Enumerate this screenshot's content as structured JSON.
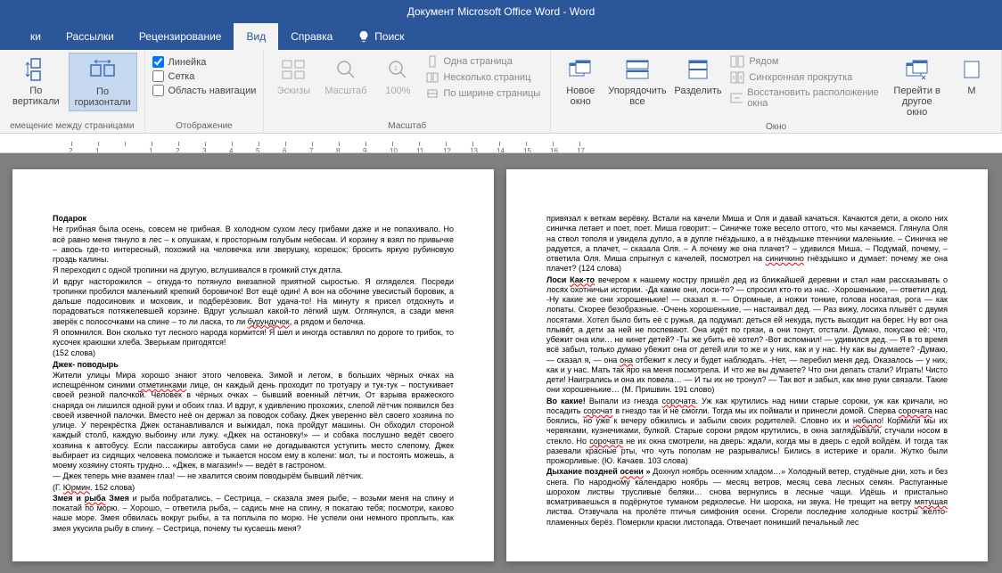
{
  "title": "Документ Microsoft Office Word  -  Word",
  "tabs": [
    "ки",
    "Рассылки",
    "Рецензирование",
    "Вид",
    "Справка"
  ],
  "activeTab": 3,
  "search": "Поиск",
  "ribbon": {
    "group1": {
      "label": "емещение между страницами",
      "btn1": "По\nвертикали",
      "btn2": "По\nгоризонтали"
    },
    "group2": {
      "label": "Отображение",
      "chk1": "Линейка",
      "chk2": "Сетка",
      "chk3": "Область навигации"
    },
    "group3": {
      "label": "Масштаб",
      "btn1": "Эскизы",
      "btn2": "Масштаб",
      "btn3": "100%",
      "opt1": "Одна страница",
      "opt2": "Несколько страниц",
      "opt3": "По ширине страницы"
    },
    "group4": {
      "label": "Окно",
      "btn1": "Новое\nокно",
      "btn2": "Упорядочить\nвсе",
      "btn3": "Разделить",
      "opt1": "Рядом",
      "opt2": "Синхронная прокрутка",
      "opt3": "Восстановить расположение окна",
      "btn4": "Перейти в\nдругое окно",
      "btn5": "М"
    }
  },
  "ruler": [
    "2",
    "1",
    "",
    "1",
    "2",
    "3",
    "4",
    "5",
    "6",
    "7",
    "8",
    "9",
    "10",
    "11",
    "12",
    "13",
    "14",
    "15",
    "16",
    "17"
  ],
  "page1": {
    "h1": "Подарок",
    "p1": "Не грибная была осень, совсем не грибная. В холодном сухом лесу грибами даже и не попахивало. Но всё равно меня тянуло в лес – к опушкам, к просторным голубым небесам. И корзину я взял по привычке – авось где-то интересный, похожий на человечка или зверушку, корешок; бросить яркую рубиновую гроздь калины.",
    "p2": "Я переходил с одной тропинки на другую, вслушивался в громкий стук дятла.",
    "p3": "И вдруг насторожился – откуда-то потянуло внезапной приятной сыростью. Я огляделся. Посреди тропинки пробился маленький крепкий боровичок! Вот ещё один! А вон на обочине увесистый боровик, а дальше подосиновик и моховик, и подберёзовик. Вот удача-то! На минуту я присел отдохнуть и порадоваться потяжелевшей корзине. Вдруг услышал какой-то лёгкий шум. Оглянулся, а сзади меня зверёк с полосочками на спине – то ли ласка, то ли ",
    "p3err": "бурундучок",
    "p3b": ", а рядом и белочка.",
    "p4": "Я опомнился. Вон сколько тут лесного народа кормится! Я шел и иногда оставлял по дороге то грибок, то кусочек краюшки хлеба. Зверькам пригодятся!",
    "p5": "(152 слова)",
    "h2": "Джек- поводырь",
    "p6a": "Жители улицы Мира хорошо знают этого человека. Зимой и летом, в больших чёрных очках на испещрённом синими ",
    "p6err": "отметинками",
    "p6b": " лице, он каждый день проходит по тротуару и тук-тук – постукивает своей резной палочкой. Человек в чёрных очках – бывший военный лётчик. От взрыва вражеского снаряда он лишился одной руки и обоих глаз. И вдруг, к удивлению прохожих, слепой лётчик появился без своей извечной палочки. Вместо неё он держал за поводок собаку. Джек уверенно вёл своего хозяина по улице. У перекрёстка Джек останавливался и выжидал, пока пройдут машины. Он обходил стороной каждый столб, каждую выбоину или лужу. «Джек на остановку!» — и собака послушно ведёт своего хозяина к автобусу. Если пассажиры автобуса сами не догадываются уступить место слепому, Джек выбирает из сидящих человека помоложе и тыкается носом ему в колени: мол, ты и постоять можешь, а моему хозяину стоять трудно… «Джек, в магазин!» — ведёт в гастроном.",
    "p7": "— Джек теперь мне взамен глаз! — не хвалится своим поводырём бывший лётчик.",
    "p8a": "(Г. ",
    "p8err": "Юрмин",
    "p8b": ". 152 слова)",
    "h3a": "Змея и ",
    "h3err": "рыба",
    "h3b": " Змея",
    "p9": " и рыба побратались. – Сестрица, – сказала змея рыбе, – возьми меня на спину и покатай по морю. – Хорошо, – ответила рыба, – садись мне на спину, я покатаю тебя; посмотри, каково наше море. Змея обвилась вокруг рыбы, а та поплыла по морю. Не успели они немного проплыть, как змея укусила рыбу в спину. – Сестрица, почему ты кусаешь меня?"
  },
  "page2": {
    "p1": "привязал к веткам верёвку. Встали на качели Миша и Оля и давай качаться. Качаются дети, а около них синичка летает и поет, поет. Миша говорит: – Синичке тоже весело оттого, что мы качаемся. Глянула Оля на ствол тополя и увидела дупло, а в дупле гнёздышко, а в гнёздышке птенчики маленькие. – Синичка не радуется, а плачет, – сказала Оля. – А почему же она плачет? – удивился Миша. – Подумай, почему, – ответила Оля. Миша спрыгнул с качелей, посмотрел на ",
    "p1err": "синичкино",
    "p1b": " гнёздышко и думает: почему же она плачет? (124 слова)",
    "h1a": "Лоси ",
    "h1err": "Как-то",
    "p2": " вечером к нашему костру пришёл дед из ближайшей деревни и стал нам рассказывать о лосях охотничьи истории. -Да какие они, лоси-то? — спросил кто-то из нас. -Хорошенькие, — ответил дед. -Ну какие же они хорошенькие! — сказал я. — Огромные, а ножки тонкие, голова носатая, рога — как лопаты. Скорее безобразные. -Очень хорошенькие, — настаивал дед. — Раз вижу, лосиха плывёт с двумя лосятами. Хотел было бить её с ружья, да подумал: деться ей некуда, пусть выходит на берег. Ну вот она плывёт, а дети за ней не поспевают. Она идёт по грязи, а они тонут, отстали. Думаю, покусаю её: что, убежит она или… не кинет детей? -Ты же убить её хотел? -Вот вспомнил! — удивился дед. — Я в то время всё забыл, только думаю убежит она от детей или то же и у них, как и у нас. Ну как вы думаете? -Думаю, — сказал я, — она ",
    "p2err": "она",
    "p2b": " отбежит к лесу и будет наблюдать. -Нет, — перебил меня дед. Оказалось — у них, как и у нас. Мать так яро на меня посмотрела. И что же вы думаете? Что они делать стали? Играть! Чисто дети! Наигрались и она их повела… — И ты их не тронул? — Так вот и забыл, как мне руки связали. Такие они хорошенькие… (М. Пришвин. 191 слово)",
    "h2": "Во какие!",
    "p3a": " Выпали из гнезда ",
    "p3err1": "сорочата",
    "p3b": ". Уж как крутились над ними старые сороки, уж как кричали, но посадить ",
    "p3err2": "сорочат",
    "p3c": " в гнездо так и не смогли. Тогда мы их поймали и принесли домой. Сперва ",
    "p3err3": "сорочата",
    "p3d": " нас боялись, но уже к вечеру обжились и забыли своих родителей. Словно их и ",
    "p3err4": "небыло",
    "p3e": "! Кормили мы их червяками, кузнечиками, булкой. Старые сороки рядом крутились, в окна заглядывали, стучали носом в стекло. Но ",
    "p3err5": "сорочата",
    "p3f": " не их окна смотрели, на дверь: ждали, когда мы в дверь с едой войдём. И тогда так разевали красные рты, что чуть пополам не разрывались! Бились в истерике и орали. Жутко были прожорливые. (Ю. Качаев. 103 слова)",
    "h3a": "Дыхание поздней ",
    "h3err": "осени",
    "h3b": " »",
    "p4a": " Дохнул ноябрь осенним хладом…» Холодный ветер, студёные дни, хоть и без снега. По народному календарю ноябрь — месяц ветров, месяц сева лесных семян. Распуганные шорохом листвы трусливые беляки… снова вернулись в лесные чащи. Идёшь и пристально всматриваешься в подёрнутое туманом редколесье. Ни шороха, ни звука. Не трещит на ветру ",
    "p4err": "мятущая",
    "p4b": " листва. Отзвучала на пролёте птичья симфония осени. Сгорели последние холодные костры жёлто-пламенных берёз. Померкли краски листопада. Отвечает поникший печальный лес"
  }
}
